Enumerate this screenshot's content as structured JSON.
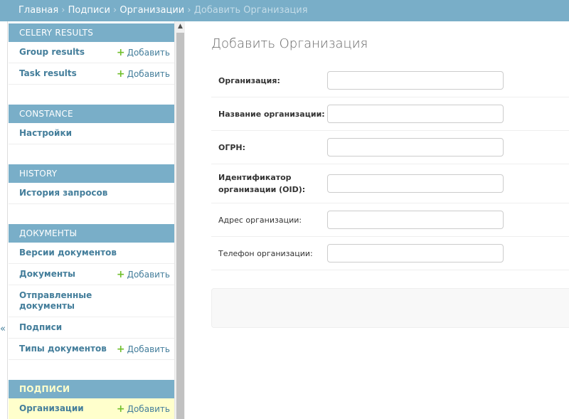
{
  "breadcrumbs": {
    "home": "Главная",
    "app": "Подписи",
    "model": "Организации",
    "current": "Добавить Организация",
    "separator": "›"
  },
  "sidebar_toggle_icon": "«",
  "sidebar": {
    "add_label": "Добавить",
    "modules": [
      {
        "caption": "CELERY RESULTS",
        "items": [
          {
            "label": "Group results",
            "has_add": true
          },
          {
            "label": "Task results",
            "has_add": true
          }
        ]
      },
      {
        "caption": "CONSTANCE",
        "items": [
          {
            "label": "Настройки",
            "has_add": false
          }
        ]
      },
      {
        "caption": "HISTORY",
        "items": [
          {
            "label": "История запросов",
            "has_add": false
          }
        ]
      },
      {
        "caption": "ДОКУМЕНТЫ",
        "items": [
          {
            "label": "Версии документов",
            "has_add": false
          },
          {
            "label": "Документы",
            "has_add": true
          },
          {
            "label": "Отправленные документы",
            "has_add": false
          },
          {
            "label": "Подписи",
            "has_add": false
          },
          {
            "label": "Типы документов",
            "has_add": true
          }
        ]
      },
      {
        "caption": "ПОДПИСИ",
        "current": true,
        "items": [
          {
            "label": "Организации",
            "has_add": true,
            "selected": true
          }
        ]
      }
    ]
  },
  "form": {
    "title": "Добавить Организация",
    "fields": [
      {
        "name": "organization",
        "label": "Организация:",
        "required": true,
        "value": ""
      },
      {
        "name": "organization_name",
        "label": "Название организации:",
        "required": true,
        "value": ""
      },
      {
        "name": "ogrn",
        "label": "ОГРН:",
        "required": true,
        "value": ""
      },
      {
        "name": "oid",
        "label": "Идентификатор организации (OID):",
        "required": true,
        "value": ""
      },
      {
        "name": "address",
        "label": "Адрес организации:",
        "required": false,
        "value": ""
      },
      {
        "name": "phone",
        "label": "Телефон организации:",
        "required": false,
        "value": ""
      }
    ]
  },
  "colors": {
    "header": "#79aec8",
    "link": "#447e9b",
    "add_plus": "#70bf2b",
    "selected_row": "#ffffcc"
  }
}
